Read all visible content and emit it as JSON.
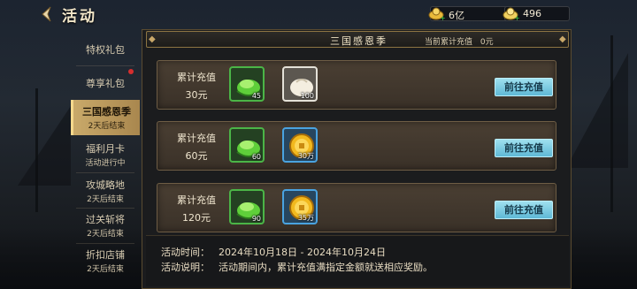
{
  "header": {
    "title": "活动",
    "back_icon": "back-arrow-icon"
  },
  "currencies": [
    {
      "name": "gold-ingot",
      "icon": "gold-ingot-icon",
      "value": "6亿"
    },
    {
      "name": "silver-ingot",
      "icon": "silver-ingot-icon",
      "value": "496"
    }
  ],
  "sidebar": {
    "tabs": [
      {
        "label": "特权礼包",
        "sub": ""
      },
      {
        "label": "尊享礼包",
        "sub": "",
        "has_dot": true
      },
      {
        "label": "三国感恩季",
        "sub": "2天后结束",
        "active": true
      },
      {
        "label": "福利月卡",
        "sub": "活动进行中"
      },
      {
        "label": "攻城略地",
        "sub": "2天后结束"
      },
      {
        "label": "过关斩将",
        "sub": "2天后结束"
      },
      {
        "label": "折扣店铺",
        "sub": "2天后结束"
      }
    ]
  },
  "panel": {
    "title": "三国感恩季",
    "total_label": "当前累计充值",
    "total_value": "0元"
  },
  "tiers": [
    {
      "label": "累计充值",
      "amount": "30元",
      "button": "前往充值",
      "rewards": [
        {
          "icon": "green-jade-icon",
          "qty": "45",
          "rarity": "green"
        },
        {
          "icon": "steamed-bun-icon",
          "qty": "100",
          "rarity": "white"
        }
      ]
    },
    {
      "label": "累计充值",
      "amount": "60元",
      "button": "前往充值",
      "rewards": [
        {
          "icon": "green-jade-icon",
          "qty": "60",
          "rarity": "green"
        },
        {
          "icon": "gold-coin-icon",
          "qty": "30万",
          "rarity": "blue"
        }
      ]
    },
    {
      "label": "累计充值",
      "amount": "120元",
      "button": "前往充值",
      "rewards": [
        {
          "icon": "green-jade-icon",
          "qty": "90",
          "rarity": "green"
        },
        {
          "icon": "gold-coin-icon",
          "qty": "35万",
          "rarity": "blue"
        }
      ]
    }
  ],
  "info": {
    "time_label": "活动时间：",
    "time_value": "2024年10月18日 - 2024年10月24日",
    "desc_label": "活动说明：",
    "desc_value": "活动期间内，累计充值满指定金额就送相应奖励。"
  },
  "colors": {
    "accent_gold": "#c9a96a",
    "button_blue": "#5fb9d6",
    "green_rarity": "#4bb547",
    "blue_rarity": "#4aa3e0"
  }
}
